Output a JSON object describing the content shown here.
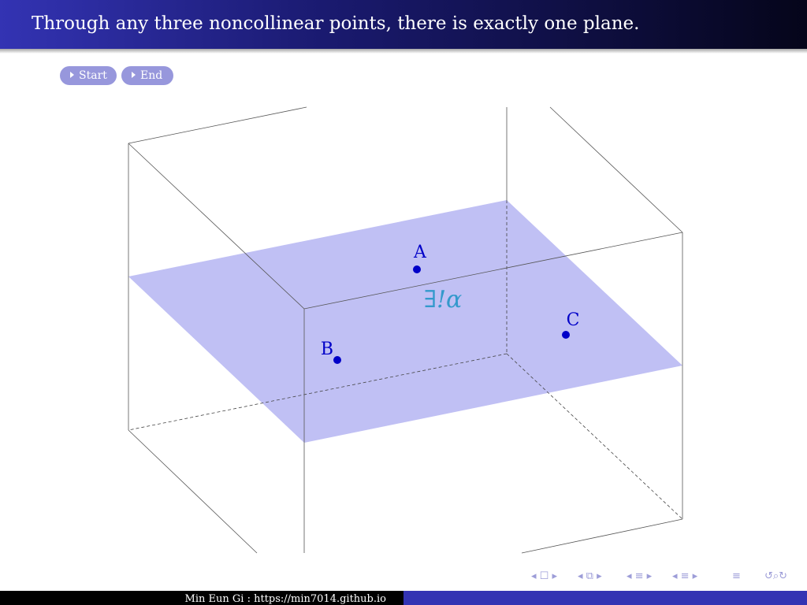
{
  "header": {
    "title": "Through any three noncollinear points, there is exactly one plane."
  },
  "controls": {
    "start_label": "Start",
    "end_label": "End"
  },
  "diagram": {
    "points": [
      {
        "label": "A"
      },
      {
        "label": "B"
      },
      {
        "label": "C"
      }
    ],
    "plane_label": "∃!α",
    "colors": {
      "plane": "#c0c0f4",
      "point": "#0000c8",
      "plane_label": "#3399cc",
      "edges": "#444444"
    }
  },
  "footer": {
    "credit": "Min Eun Gi : https://min7014.github.io"
  },
  "navigation": {
    "icons": [
      "slide-nav-icon",
      "frame-nav-icon",
      "subsection-nav-icon",
      "section-nav-icon",
      "outline-icon",
      "search-icon"
    ]
  }
}
